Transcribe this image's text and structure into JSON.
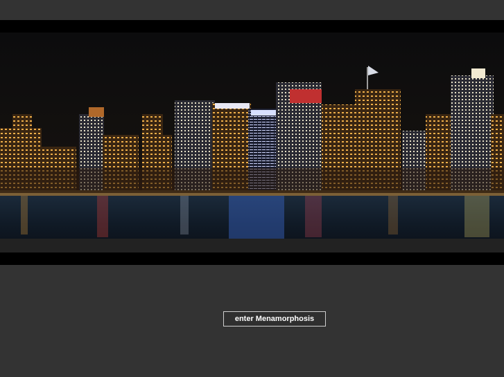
{
  "enter_button": {
    "label": "enter Menamorphosis"
  },
  "skyline_image": {
    "description_name": "city-skyline-night-photo"
  },
  "colors": {
    "page_background": "#333333",
    "banner_background": "#000000",
    "button_border": "#cfcfcf",
    "button_text": "#ffffff"
  }
}
